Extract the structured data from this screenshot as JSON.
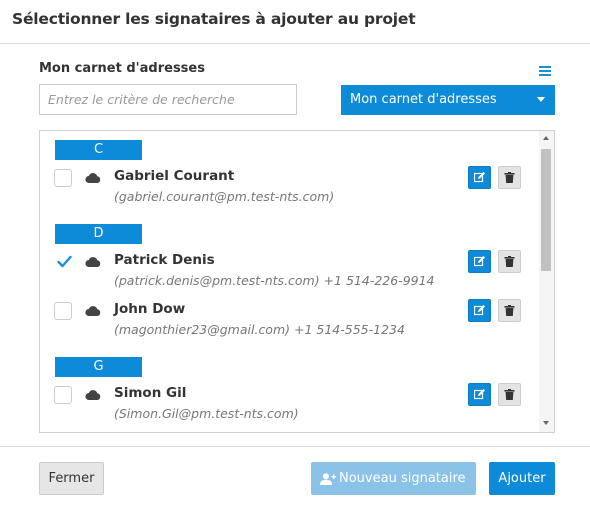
{
  "dialog": {
    "title": "Sélectionner les signataires à ajouter au projet"
  },
  "address_book": {
    "label": "Mon carnet d'adresses",
    "search_placeholder": "Entrez le critère de recherche",
    "search_value": "",
    "dropdown_value": "Mon carnet d'adresses"
  },
  "groups": [
    {
      "letter": "C",
      "contacts": [
        {
          "name": "Gabriel Courant",
          "detail": "(gabriel.courant@pm.test-nts.com)",
          "checked": false
        }
      ]
    },
    {
      "letter": "D",
      "contacts": [
        {
          "name": "Patrick Denis",
          "detail": "(patrick.denis@pm.test-nts.com) +1 514-226-9914",
          "checked": true
        },
        {
          "name": "John Dow",
          "detail": "(magonthier23@gmail.com) +1 514-555-1234",
          "checked": false
        }
      ]
    },
    {
      "letter": "G",
      "contacts": [
        {
          "name": "Simon Gil",
          "detail": "(Simon.Gil@pm.test-nts.com)",
          "checked": false
        }
      ]
    }
  ],
  "footer": {
    "close_label": "Fermer",
    "new_signer_label": "Nouveau signataire",
    "add_label": "Ajouter"
  },
  "icons": {
    "menu": "hamburger-icon",
    "cloud": "cloud-icon",
    "edit": "edit-icon",
    "delete": "trash-icon",
    "checkmark": "checkmark-icon",
    "add_user": "add-user-icon"
  },
  "colors": {
    "accent": "#0d8ad8",
    "accent_disabled": "#8ac2e8",
    "group_header": "#0d8ad8",
    "secondary_button": "#e6e6e6"
  },
  "scroll_position": 0
}
